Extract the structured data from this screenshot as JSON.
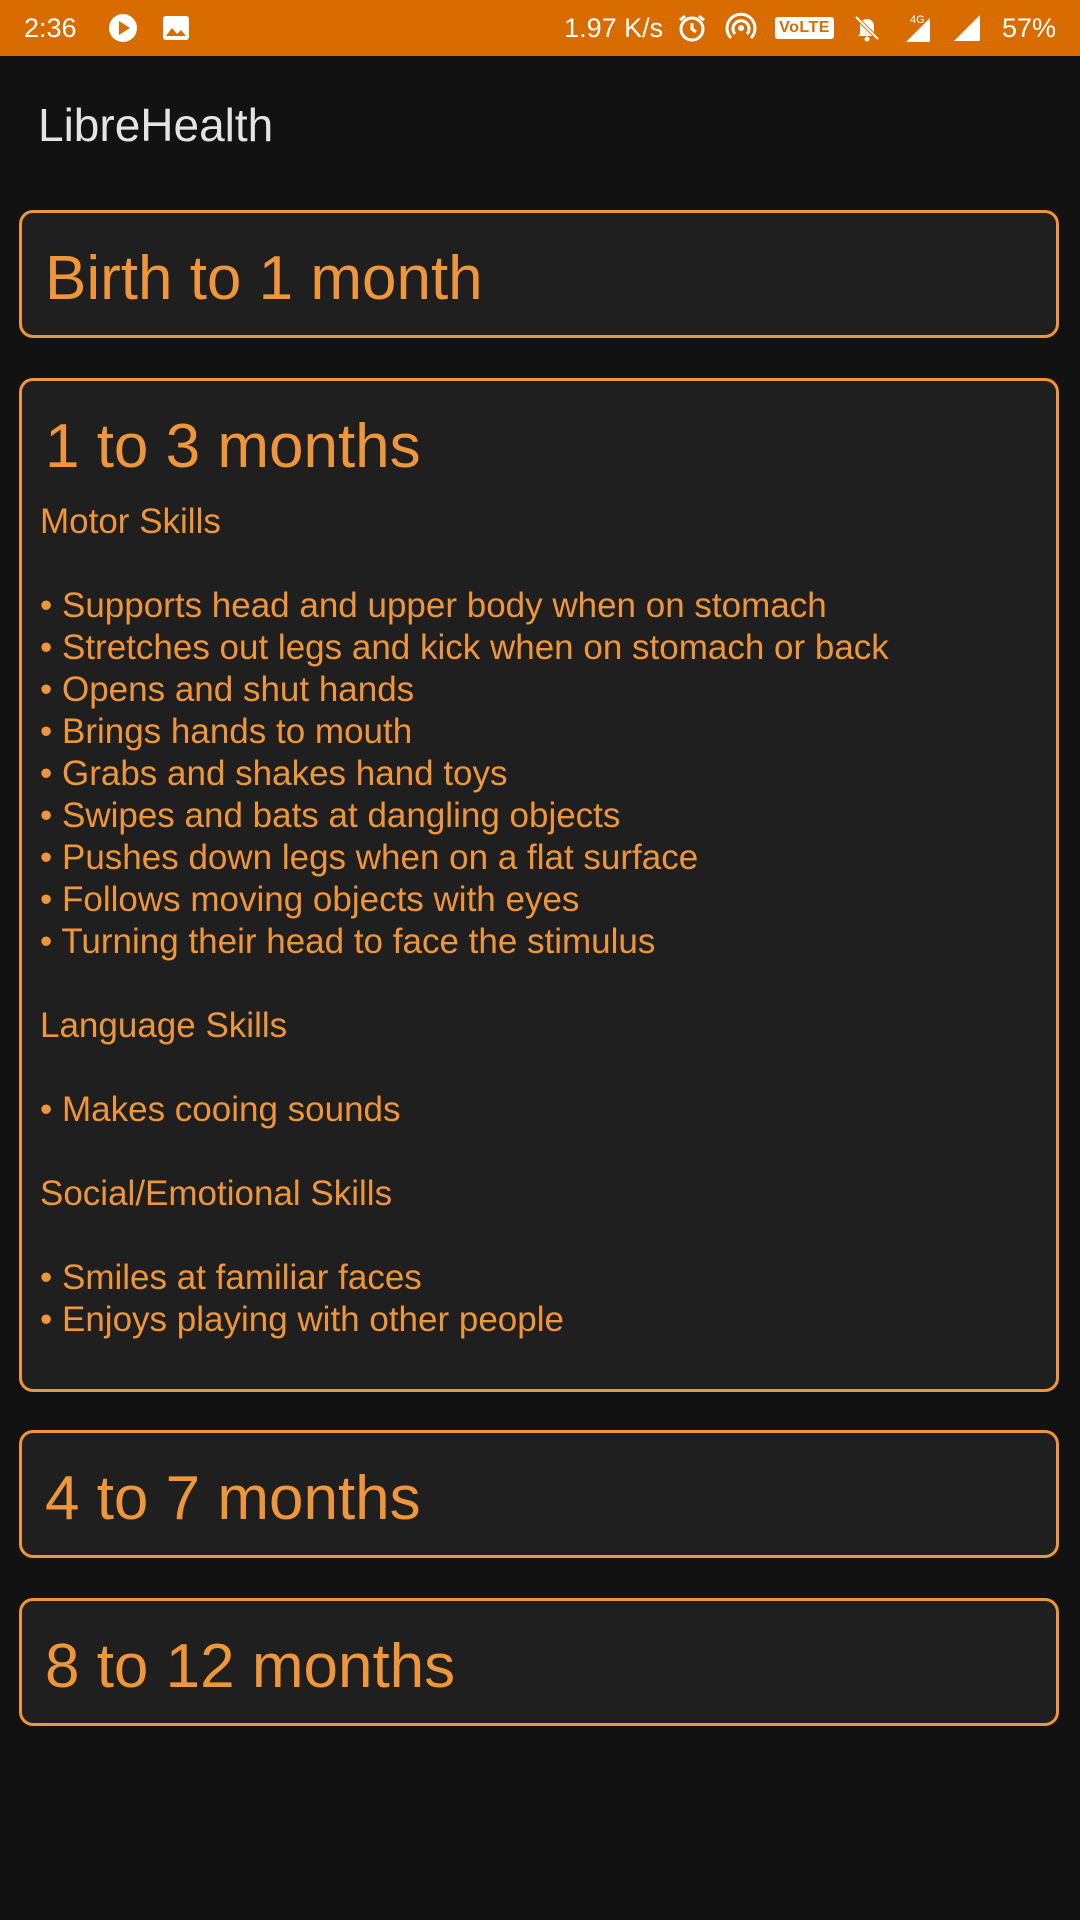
{
  "status_bar": {
    "time": "2:36",
    "net_speed": "1.97 K/s",
    "volte": "VoLTE",
    "network_type": "4G",
    "battery": "57%"
  },
  "app": {
    "title": "LibreHealth"
  },
  "cards": [
    {
      "title": "Birth to 1 month",
      "expanded": false
    },
    {
      "title": "1 to 3 months",
      "expanded": true,
      "sections": [
        {
          "heading": "Motor Skills",
          "items": [
            "• Supports head and upper body when on stomach",
            "• Stretches out legs and kick when on stomach or back",
            "• Opens and shut hands",
            "• Brings hands to mouth",
            "• Grabs and shakes hand toys",
            "• Swipes and bats at dangling objects",
            "• Pushes down legs when on a flat surface",
            "• Follows moving objects with eyes",
            "• Turning their head to face the stimulus"
          ]
        },
        {
          "heading": "Language Skills",
          "items": [
            "• Makes cooing sounds"
          ]
        },
        {
          "heading": "Social/Emotional Skills",
          "items": [
            "• Smiles at familiar faces",
            "• Enjoys playing with other people"
          ]
        }
      ]
    },
    {
      "title": "4 to 7 months",
      "expanded": false
    },
    {
      "title": "8 to 12 months",
      "expanded": false
    }
  ],
  "colors": {
    "status_bar": "#d86c00",
    "background": "#121212",
    "card_background": "#1f1f1f",
    "accent": "#f0963a",
    "title_text": "#e4e4e4"
  }
}
